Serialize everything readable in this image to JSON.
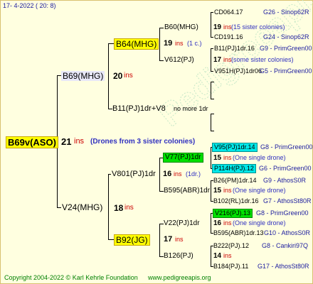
{
  "header": {
    "date": "17-  4-2022 ( 20:  8)"
  },
  "footer": {
    "copyright": "Copyright 2004-2022 © Karl Kehrle Foundation",
    "site": "www.pedigreeapis.org"
  },
  "watermark": "Pedigreeapis",
  "root": {
    "name": "B69v(ASO)",
    "count": "21",
    "ins": "ins",
    "note": "(Drones from 3 sister colonies)"
  },
  "sire": {
    "name": "B69(MHG)",
    "count": "20",
    "ins": "ins"
  },
  "dam": {
    "name": "V24(MHG)",
    "count": "18",
    "ins": "ins"
  },
  "b64": {
    "name": "B64(MHG)",
    "count": "19",
    "ins": "ins",
    "note": "(1 c.)"
  },
  "b11": {
    "name": "B11(PJ)1dr+V8",
    "note": "no more 1dr"
  },
  "v801": {
    "name": "V801(PJ)1dr",
    "count": "16",
    "ins": "ins",
    "note": "(1dr.)"
  },
  "b92": {
    "name": "B92(JG)",
    "count": "17",
    "ins": "ins"
  },
  "b60": {
    "name": "B60(MHG)",
    "count": "19",
    "ins": "ins",
    "note": "(15 sister colonies)"
  },
  "v612": {
    "name": "V612(PJ)",
    "count": "17",
    "ins": "ins",
    "note": "(some sister colonies)"
  },
  "v77": {
    "name": "V77(PJ)1dr",
    "count": "15",
    "ins": "ins",
    "note": "(One single drone)"
  },
  "b595a": {
    "name": "B595(ABR)1dr",
    "count": "15",
    "ins": "ins",
    "note": "(One single drone)"
  },
  "v22": {
    "name": "V22(PJ)1dr",
    "count": "16",
    "ins": "ins",
    "note": "(One single drone)"
  },
  "b126": {
    "name": "B126(PJ)",
    "count": "14",
    "ins": "ins"
  },
  "leaves": [
    {
      "name": "CD064.17",
      "right": "G26 - Sinop62R"
    },
    {
      "name": "CD191.16",
      "right": "G24 - Sinop62R"
    },
    {
      "name": "B11(PJ)1dr.16",
      "right": "G9 - PrimGreen00"
    },
    {
      "name": "V951H(PJ)1dr06",
      "right": "G5 - PrimGreen00"
    },
    {
      "name": "V95(PJ)1dr.14",
      "right": "G8 - PrimGreen00"
    },
    {
      "name": "P114H(PJ).12",
      "right": "G6 - PrimGreen00"
    },
    {
      "name": "B26(PM)1dr.14",
      "right": "G9 - AthosS0R"
    },
    {
      "name": "B102(RL)1dr.16",
      "right": "G7 - AthosSt80R"
    },
    {
      "name": "V216(PJ).13",
      "right": "G8 - PrimGreen00"
    },
    {
      "name": "B595(ABR)1dr.13",
      "right": "G10 - AthosS0R"
    },
    {
      "name": "B222(PJ).12",
      "right": "G8 - Cankiri97Q"
    },
    {
      "name": "B184(PJ).11",
      "right": "G17 - AthosSt80R"
    }
  ]
}
